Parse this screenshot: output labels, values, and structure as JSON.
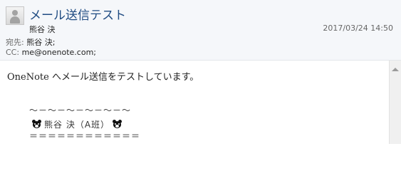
{
  "email": {
    "subject": "メール送信テスト",
    "sender": "熊谷 決",
    "timestamp": "2017/03/24 14:50",
    "to_label": "宛先:",
    "to_value": " 熊谷 決;",
    "cc_label": "CC:",
    "cc_value": "  me@onenote.com;"
  },
  "body": {
    "intro_brand": "OneNote",
    "intro_text": " へメール送信をテストしています。",
    "sig_line1": "～－～－～－～－～－～",
    "sig_name": "熊谷 決（A班）",
    "sig_line3": "＝＝＝＝＝＝＝＝＝＝＝＝",
    "icons": {
      "contact": "person-icon",
      "bear": "bear-icon",
      "scroll": "scroll-up-arrow-icon"
    }
  },
  "colors": {
    "subject": "#1f4b82",
    "header_bg": "#f5f7fa"
  }
}
